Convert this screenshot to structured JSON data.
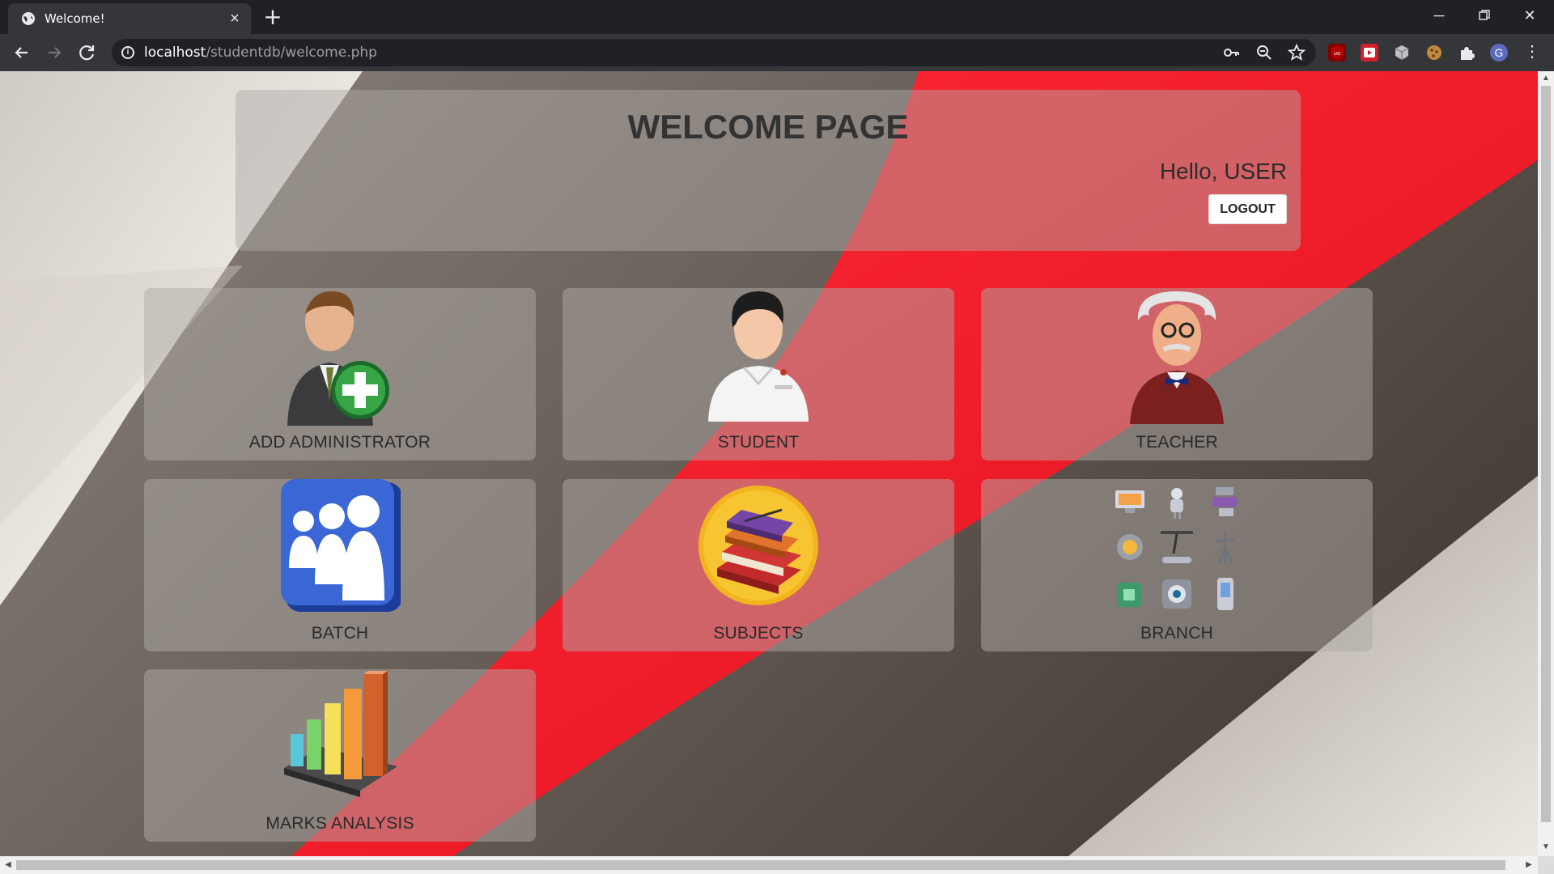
{
  "browser": {
    "tab_title": "Welcome!",
    "url_host": "localhost",
    "url_path": "/studentdb/welcome.php",
    "profile_initial": "G"
  },
  "header": {
    "title": "WELCOME PAGE",
    "greeting": "Hello, USER",
    "logout_label": "LOGOUT"
  },
  "cards": [
    {
      "label": "ADD ADMINISTRATOR",
      "icon": "add-admin-icon"
    },
    {
      "label": "STUDENT",
      "icon": "student-icon"
    },
    {
      "label": "TEACHER",
      "icon": "teacher-icon"
    },
    {
      "label": "BATCH",
      "icon": "batch-icon"
    },
    {
      "label": "SUBJECTS",
      "icon": "subjects-icon"
    },
    {
      "label": "BRANCH",
      "icon": "branch-icon"
    },
    {
      "label": "MARKS ANALYSIS",
      "icon": "marks-analysis-icon"
    }
  ],
  "colors": {
    "accent_red": "#ff1a2b",
    "card_bg": "rgba(175,170,165,0.5)"
  }
}
